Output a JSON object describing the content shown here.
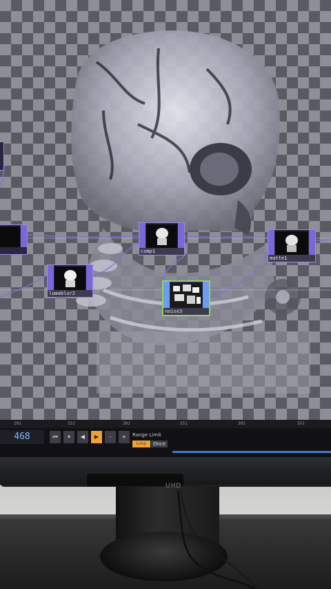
{
  "network": {
    "nodes": [
      {
        "id": "comp1",
        "label": "comp1"
      },
      {
        "id": "matte1",
        "label": "matte1"
      },
      {
        "id": "lumablur2",
        "label": "lumablur2"
      },
      {
        "id": "noise3",
        "label": "noise3"
      }
    ]
  },
  "timeline": {
    "ruler_ticks": [
      "101",
      "151",
      "201",
      "251",
      "301",
      "351"
    ],
    "current_frame": "468",
    "buttons": [
      "⏮",
      "⏸",
      "◀",
      "▶",
      "-",
      "+"
    ],
    "range_limit_label": "Range Limit",
    "range_loop": "Loop",
    "range_once": "Once"
  },
  "monitor": {
    "badge": "UHD"
  }
}
